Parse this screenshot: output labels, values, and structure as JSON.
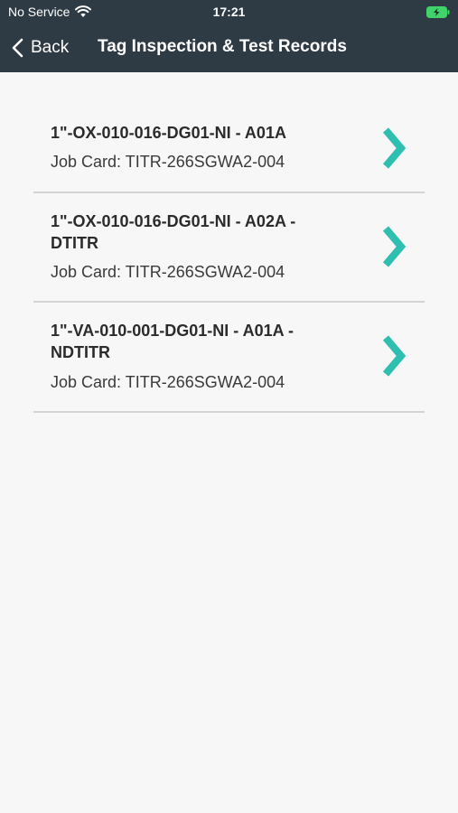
{
  "status_bar": {
    "carrier": "No Service",
    "time": "17:21",
    "wifi_icon": "wifi-icon",
    "battery_icon": "battery-charging-icon"
  },
  "nav": {
    "back_label": "Back",
    "title": "Tag Inspection & Test Records"
  },
  "records": [
    {
      "title": "1\"-OX-010-016-DG01-NI - A01A",
      "job_card": "Job Card: TITR-266SGWA2-004"
    },
    {
      "title": "1\"-OX-010-016-DG01-NI - A02A - DTITR",
      "job_card": "Job Card: TITR-266SGWA2-004"
    },
    {
      "title": "1\"-VA-010-001-DG01-NI - A01A - NDTITR",
      "job_card": "Job Card: TITR-266SGWA2-004"
    }
  ],
  "colors": {
    "header_bg": "#2e3b44",
    "accent": "#2ebfb0",
    "battery": "#3fd36a",
    "divider": "#d4d4d4"
  }
}
